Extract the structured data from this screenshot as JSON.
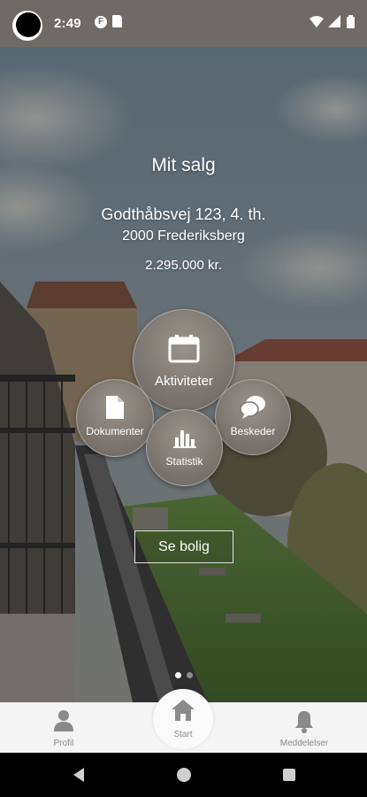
{
  "status_bar": {
    "time": "2:49",
    "left_icons": [
      "f-circle-icon",
      "sd-card-icon"
    ],
    "right_icons": [
      "wifi-icon",
      "cellular-icon",
      "battery-icon"
    ]
  },
  "hero": {
    "title": "Mit salg",
    "address": "Godthåbsvej 123, 4. th.",
    "city": "2000 Frederiksberg",
    "price": "2.295.000 kr."
  },
  "actions": {
    "aktiviteter": {
      "label": "Aktiviteter",
      "icon": "calendar-icon"
    },
    "dokumenter": {
      "label": "Dokumenter",
      "icon": "document-icon"
    },
    "beskeder": {
      "label": "Beskeder",
      "icon": "chat-bubbles-icon"
    },
    "statistik": {
      "label": "Statistik",
      "icon": "bar-chart-icon"
    }
  },
  "se_bolig_label": "Se bolig",
  "pager": {
    "count": 2,
    "active": 1
  },
  "bottom_nav": {
    "profil": {
      "label": "Profil",
      "icon": "person-icon"
    },
    "start": {
      "label": "Start",
      "icon": "home-icon"
    },
    "meddelelser": {
      "label": "Meddelelser",
      "icon": "bell-icon"
    }
  },
  "colors": {
    "status_bar": "#6f6a65",
    "bubble": "#7d7670",
    "nav_background": "#f4f4f4",
    "nav_icon": "#8a8a8a"
  }
}
